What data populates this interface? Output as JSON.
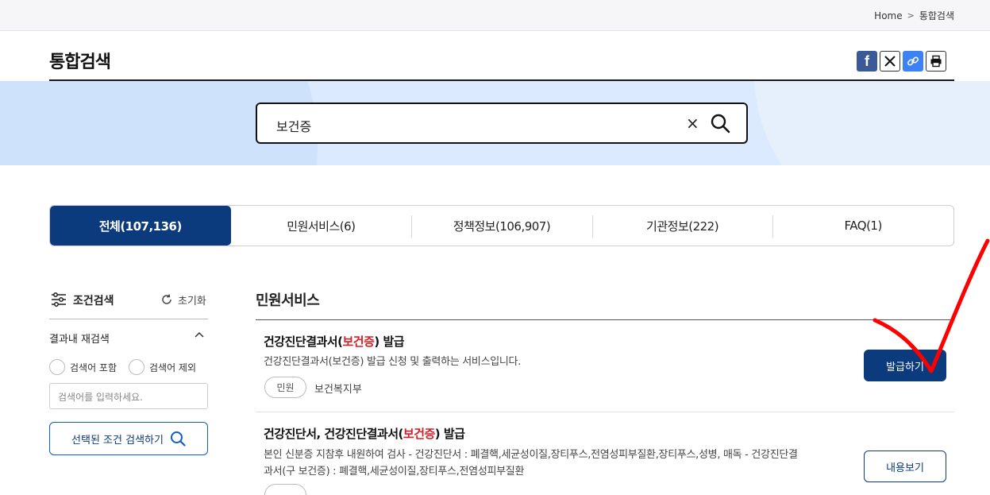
{
  "breadcrumb": {
    "home": "Home",
    "separator": ">",
    "current": "통합검색"
  },
  "page": {
    "title": "통합검색"
  },
  "share": {
    "facebook": "f"
  },
  "search": {
    "query": "보건증",
    "clear": "×"
  },
  "tabs": [
    {
      "label": "전체(107,136)",
      "active": true
    },
    {
      "label": "민원서비스(6)",
      "active": false
    },
    {
      "label": "정책정보(106,907)",
      "active": false
    },
    {
      "label": "기관정보(222)",
      "active": false
    },
    {
      "label": "FAQ(1)",
      "active": false
    }
  ],
  "sidebar": {
    "heading": "조건검색",
    "reset": "초기화",
    "refine_title": "결과내 재검색",
    "radio_include": "검색어 포함",
    "radio_exclude": "검색어 제외",
    "input_placeholder": "검색어를 입력하세요.",
    "search_button": "선택된 조건 검색하기"
  },
  "results": {
    "section_title": "민원서비스",
    "items": [
      {
        "title_pre": "건강진단결과서(",
        "title_hl": "보건증",
        "title_post": ") 발급",
        "desc": "건강진단결과서(보건증) 발급 신청 및 출력하는 서비스입니다.",
        "chip": "민원",
        "org": "보건복지부",
        "button": "발급하기"
      },
      {
        "title_pre": "건강진단서, 건강진단결과서(",
        "title_hl": "보건증",
        "title_post": ") 발급",
        "desc_line1": "본인 신분증 지참후 내원하여 검사 - 건강진단서 : 폐결핵,세균성이질,장티푸스,전염성피부질환,장티푸스,성병, 매독 - 건강진단결",
        "desc_line2": "과서(구 보건증) : 폐결핵,세균성이질,장티푸스,전염성피부질환",
        "button": "내용보기"
      }
    ]
  },
  "colors": {
    "primary": "#0b3a7d",
    "highlight": "#d81f26",
    "hero": "#dbeafe",
    "annotation": "#ff0000"
  }
}
